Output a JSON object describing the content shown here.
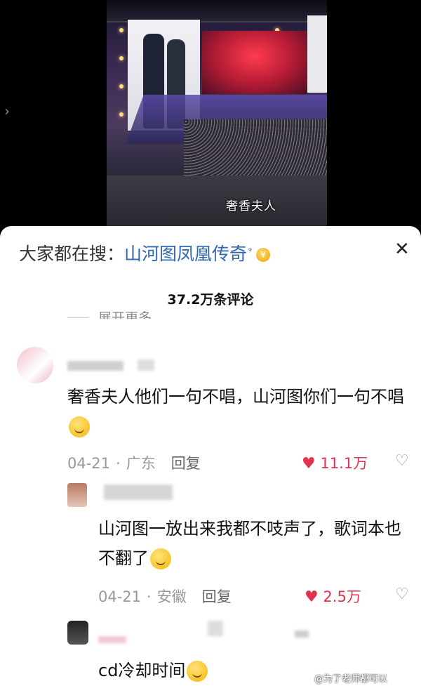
{
  "video": {
    "caption": "奢香夫人",
    "back_icon": "chevron-right-icon"
  },
  "search": {
    "prefix": "大家都在搜：",
    "term": "山河图凤凰传奇",
    "mini_icon": "search-icon",
    "coin_label": "¥",
    "close_label": "✕"
  },
  "comments_header": {
    "count": "37.2万条评论",
    "expand_label": "展开更多"
  },
  "comments": [
    {
      "text": "奢香夫人他们一句不唱，山河图你们一句不唱",
      "date": "04-21",
      "location": "广东",
      "reply_label": "回复",
      "likes": "11.1万"
    },
    {
      "text": "山河图一放出来我都不吱声了，歌词本也不翻了",
      "date": "04-21",
      "location": "安徽",
      "reply_label": "回复",
      "likes": "2.5万"
    },
    {
      "text": "cd冷却时间"
    }
  ],
  "watermark": "@为了老师都可以",
  "colors": {
    "accent_blue": "#2f66b2",
    "like_red": "#e1334d"
  }
}
